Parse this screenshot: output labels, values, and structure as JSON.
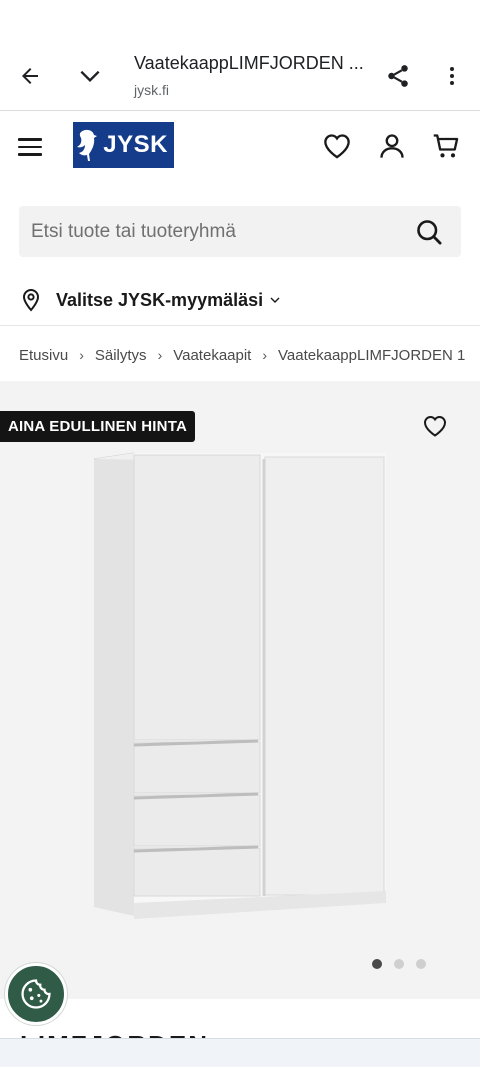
{
  "browser": {
    "page_title": "VaatekaappLIMFJORDEN ...",
    "url": "jysk.fi"
  },
  "header": {
    "logo_text": "JYSK",
    "brand_color": "#143c8a"
  },
  "search": {
    "placeholder": "Etsi tuote tai tuoteryhmä"
  },
  "store": {
    "label": "Valitse JYSK-myymäläsi"
  },
  "breadcrumb": [
    "Etusivu",
    "Säilytys",
    "Vaatekaapit",
    "VaatekaappLIMFJORDEN 1"
  ],
  "product": {
    "badge": "AINA EDULLINEN HINTA",
    "image_count": 3,
    "active_image": 1,
    "title_partial": "LIMFJORDEN"
  },
  "icons": {
    "back": "arrow-left-icon",
    "tabs": "chevron-down-icon",
    "share": "share-icon",
    "more": "more-vertical-icon",
    "menu": "hamburger-icon",
    "wishlist": "heart-icon",
    "account": "user-icon",
    "cart": "cart-icon",
    "search": "search-icon",
    "store": "location-pin-icon",
    "cookie": "cookie-icon"
  },
  "colors": {
    "badge_bg": "#141414",
    "cookie_bg": "#2f5b47",
    "gallery_bg": "#f3f3f3"
  }
}
